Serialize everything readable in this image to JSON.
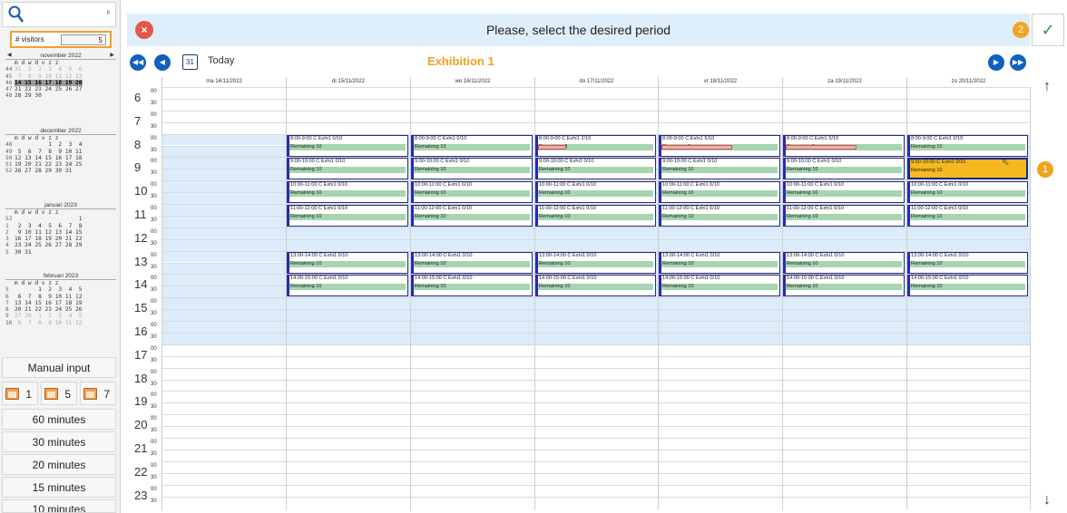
{
  "left": {
    "visitors_label": "# visitors",
    "visitors_value": "5",
    "pin": "ᵖ",
    "months": [
      {
        "name": "november 2022",
        "days_header": "m d w d v z z",
        "rows": [
          {
            "wk": "44",
            "days": "31  1  2  3  4  5  6"
          },
          {
            "wk": "45",
            "days": " 7  8  9 10 11 12 13"
          },
          {
            "wk": "46",
            "days": "14 15 16 17 18 19 20"
          },
          {
            "wk": "47",
            "days": "21 22 23 24 25 26 27"
          },
          {
            "wk": "48",
            "days": "28 29 30"
          }
        ]
      },
      {
        "name": "december 2022",
        "days_header": "m d w d v z z",
        "rows": [
          {
            "wk": "48",
            "days": "          1  2  3  4"
          },
          {
            "wk": "49",
            "days": " 5  6  7  8  9 10 11"
          },
          {
            "wk": "50",
            "days": "12 13 14 15 16 17 18"
          },
          {
            "wk": "51",
            "days": "19 20 21 22 23 24 25"
          },
          {
            "wk": "52",
            "days": "26 27 28 29 30 31"
          }
        ]
      },
      {
        "name": "januari 2023",
        "days_header": "m d w d v z z",
        "rows": [
          {
            "wk": "52",
            "days": "                   1"
          },
          {
            "wk": "1",
            "days": " 2  3  4  5  6  7  8"
          },
          {
            "wk": "2",
            "days": " 9 10 11 12 13 14 15"
          },
          {
            "wk": "3",
            "days": "16 17 18 19 20 21 22"
          },
          {
            "wk": "4",
            "days": "23 24 25 26 27 28 29"
          },
          {
            "wk": "5",
            "days": "30 31"
          }
        ]
      },
      {
        "name": "februari 2023",
        "days_header": "m d w d v z z",
        "rows": [
          {
            "wk": "5",
            "days": "       1  2  3  4  5"
          },
          {
            "wk": "6",
            "days": " 6  7  8  9 10 11 12"
          },
          {
            "wk": "7",
            "days": "13 14 15 16 17 18 19"
          },
          {
            "wk": "8",
            "days": "20 21 22 23 24 25 26"
          },
          {
            "wk": "9",
            "days": "27 28  1  2  3  4  5"
          },
          {
            "wk": "10",
            "days": " 6  7  8  9 10 11 12"
          }
        ]
      }
    ],
    "manual_input": "Manual input",
    "day_buttons": [
      "1",
      "5",
      "7"
    ],
    "durations": [
      "60 minutes",
      "30 minutes",
      "20 minutes",
      "15 minutes",
      "10 minutes"
    ]
  },
  "header": {
    "title": "Please, select the desired period",
    "close_icon": "×",
    "ok_icon": "✓",
    "badge_ok": "2",
    "badge_slot": "1"
  },
  "nav": {
    "today": "Today",
    "calendar_icon_day": "31",
    "exhibition": "Exhibition 1"
  },
  "days": [
    "ma 14/11/2022",
    "di 15/11/2022",
    "wo 16/11/2022",
    "do 17/11/2022",
    "vr 18/11/2022",
    "za 19/11/2022",
    "zo 20/11/2022"
  ],
  "hours": [
    "6",
    "7",
    "8",
    "9",
    "10",
    "11",
    "12",
    "13",
    "14",
    "15",
    "16",
    "17",
    "18",
    "19",
    "20",
    "21",
    "22",
    "23"
  ],
  "minute_marks": {
    "top": "00",
    "half": "30"
  },
  "slots": [
    {
      "time": "8:00-9:00",
      "row": 8
    },
    {
      "time": "9:00-10:00",
      "row": 9
    },
    {
      "time": "10:00-11:00",
      "row": 10
    },
    {
      "time": "11:00-12:00",
      "row": 11
    },
    {
      "time": "13:00-14:00",
      "row": 13
    },
    {
      "time": "14:00-15:00",
      "row": 14
    }
  ],
  "slot_texts": {
    "day1": [
      "8:00-9:00 C Exhi1 0/10",
      "9:00-10:00 C Exhi1 0/10",
      "10:00-11:00 C Exhi1 0/10",
      "11:00-12:00 C Exhi1 0/10",
      "13:00-14:00 C Exhi1 0/10",
      "14:00-15:00 C Exhi1 0/10"
    ],
    "day2": [
      "8:00-9:00 C Exhi1 0/10",
      "9:00-10:00 C Exhi1 0/10",
      "10:00-11:00 C Exhi1 0/10",
      "11:00-12:00 C Exhi1 0/10",
      "13:00-14:00 C Exhi1 0/10",
      "14:00-15:00 C Exhi1 0/10"
    ],
    "day3": [
      "8:00-9:00 C Exhi1 2/10",
      "9:00-10:00 C Exhi1 0/10",
      "10:00-11:00 C Exhi1 0/10",
      "11:00-12:00 C Exhi1 0/10",
      "13:00-14:00 C Exhi1 0/10",
      "14:00-15:00 C Exhi1 0/10"
    ],
    "day4": [
      "8:00-9:00 C Exhi1 5/10",
      "9:00-10:00 C Exhi1 0/10",
      "10:00-11:00 C Exhi1 0/10",
      "11:00-12:00 C Exhi1 0/10",
      "13:00-14:00 C Exhi1 0/10",
      "14:00-15:00 C Exhi1 0/10"
    ],
    "day5": [
      "8:00-9:00 C Exhi1 5/10",
      "9:00-10:00 C Exhi1 0/10",
      "10:00-11:00 C Exhi1 0/10",
      "11:00-12:00 C Exhi1 0/10",
      "13:00-14:00 C Exhi1 0/10",
      "14:00-15:00 C Exhi1 0/10"
    ],
    "day6": [
      "8:00-9:00 C Exhi1 0/10",
      "9:00-10:00 C Exhi1 0/10",
      "10:00-11:00 C Exhi1 0/10",
      "11:00-12:00 C Exhi1 0/10",
      "13:00-14:00 C Exhi1 0/10",
      "14:00-15:00 C Exhi1 0/10"
    ]
  },
  "remaining": {
    "day1": [
      "Remaining 10",
      "Remaining 10",
      "Remaining 10",
      "Remaining 10",
      "Remaining 10",
      "Remaining 10"
    ],
    "day2": [
      "Remaining 10",
      "Remaining 10",
      "Remaining 10",
      "Remaining 10",
      "Remaining 10",
      "Remaining 10"
    ],
    "day3": [
      "Remaining 8",
      "Remaining 10",
      "Remaining 10",
      "Remaining 10",
      "Remaining 10",
      "Remaining 10"
    ],
    "day4": [
      "Remaining 5",
      "Remaining 10",
      "Remaining 10",
      "Remaining 10",
      "Remaining 10",
      "Remaining 10"
    ],
    "day5": [
      "Remaining 5",
      "Remaining 10",
      "Remaining 10",
      "Remaining 10",
      "Remaining 10",
      "Remaining 10"
    ],
    "day6": [
      "Remaining 10",
      "Remaining 10",
      "Remaining 10",
      "Remaining 10",
      "Remaining 10",
      "Remaining 10"
    ]
  },
  "booked_fraction": {
    "day3": [
      0.2,
      0,
      0,
      0,
      0,
      0
    ],
    "day4": [
      0.5,
      0,
      0,
      0,
      0,
      0
    ],
    "day5": [
      0.5,
      0,
      0,
      0,
      0,
      0
    ]
  },
  "selected": {
    "day": 6,
    "slot": 1
  },
  "colors": {
    "accent": "#f0a520",
    "slot_green": "#a6d5b0",
    "nav_blue": "#1160c0",
    "selected": "#f5b820"
  }
}
